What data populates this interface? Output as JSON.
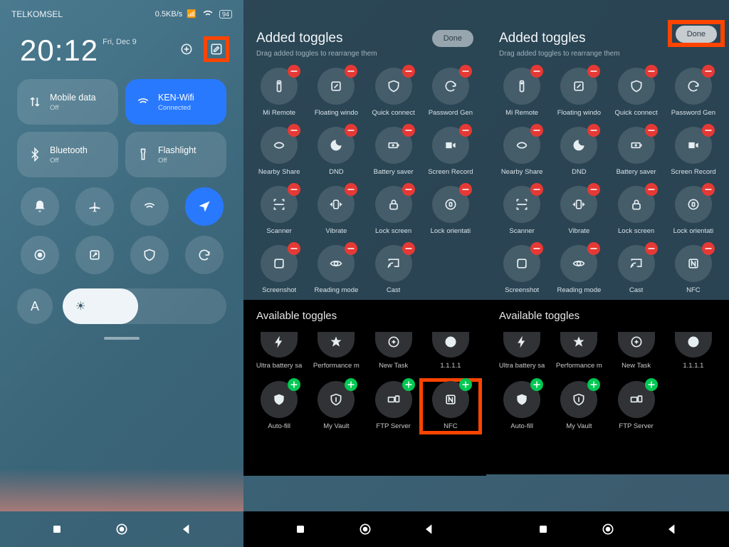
{
  "panel1": {
    "carrier": "TELKOMSEL",
    "speed": "0.5KB/s",
    "battery": "94",
    "time": "20:12",
    "date": "Fri, Dec 9",
    "tiles": [
      {
        "name": "mobile-data",
        "label": "Mobile data",
        "sub": "Off",
        "active": false
      },
      {
        "name": "wifi",
        "label": "KEN-Wifi",
        "sub": "Connected",
        "active": true
      },
      {
        "name": "bluetooth",
        "label": "Bluetooth",
        "sub": "Off",
        "active": false
      },
      {
        "name": "flashlight",
        "label": "Flashlight",
        "sub": "Off",
        "active": false
      }
    ],
    "circles": [
      "bell",
      "airplane",
      "wifi-sleep",
      "location",
      "record",
      "fullscreen",
      "shield",
      "sync"
    ],
    "auto_label": "A"
  },
  "edit": {
    "title": "Added toggles",
    "subtitle": "Drag added toggles to rearrange them",
    "done": "Done",
    "added": [
      {
        "name": "mi-remote",
        "label": "Mi Remote"
      },
      {
        "name": "floating-window",
        "label": "Floating windo"
      },
      {
        "name": "quick-connect",
        "label": "Quick connect"
      },
      {
        "name": "password-gen",
        "label": "Password Gen"
      },
      {
        "name": "nearby-share",
        "label": "Nearby Share"
      },
      {
        "name": "dnd",
        "label": "DND"
      },
      {
        "name": "battery-saver",
        "label": "Battery saver"
      },
      {
        "name": "screen-record",
        "label": "Screen Record"
      },
      {
        "name": "scanner",
        "label": "Scanner"
      },
      {
        "name": "vibrate",
        "label": "Vibrate"
      },
      {
        "name": "lock-screen",
        "label": "Lock screen"
      },
      {
        "name": "lock-orientation",
        "label": "Lock orientati"
      },
      {
        "name": "screenshot",
        "label": "Screenshot"
      },
      {
        "name": "reading-mode",
        "label": "Reading mode"
      },
      {
        "name": "cast",
        "label": "Cast"
      }
    ],
    "nfc": {
      "name": "nfc",
      "label": "NFC"
    },
    "available_title": "Available toggles",
    "available_partial": [
      {
        "name": "ultra-battery",
        "label": "Ultra battery sa"
      },
      {
        "name": "performance",
        "label": "Performance m"
      },
      {
        "name": "new-task",
        "label": "New Task"
      },
      {
        "name": "one-one-one-one",
        "label": "1.1.1.1"
      }
    ],
    "available_full": [
      {
        "name": "auto-fill",
        "label": "Auto-fill"
      },
      {
        "name": "my-vault",
        "label": "My Vault"
      },
      {
        "name": "ftp-server",
        "label": "FTP Server"
      }
    ],
    "available_nfc": {
      "name": "nfc-avail",
      "label": "NFC"
    }
  }
}
